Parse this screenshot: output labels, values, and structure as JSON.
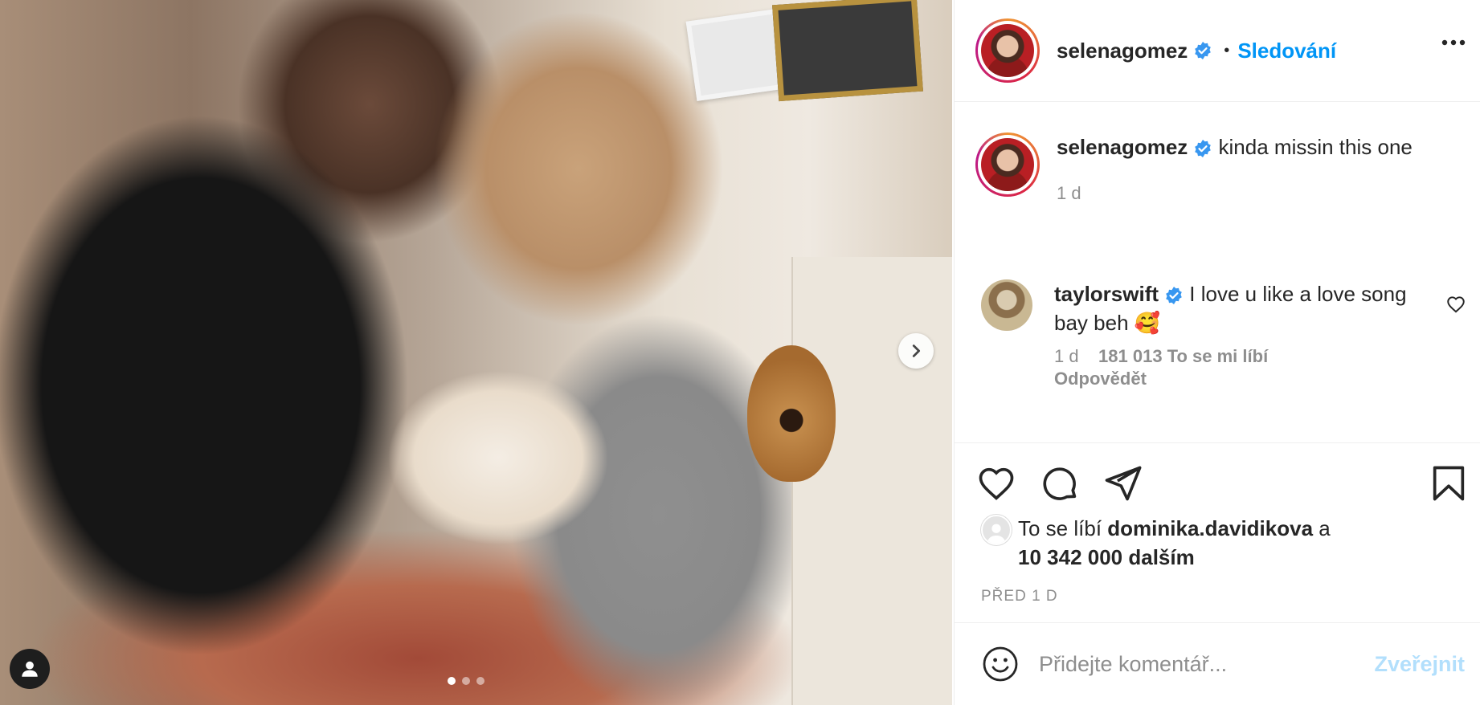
{
  "post": {
    "author": "selenagomez",
    "follow_separator": "•",
    "follow_label": "Sledování",
    "caption_text": "kinda missin this one",
    "caption_time": "1 d"
  },
  "comment": {
    "author": "taylorswift",
    "text": "I love u like a love song bay beh 🥰",
    "time": "1 d",
    "likes": "181 013 To se mi líbí",
    "reply_label": "Odpovědět"
  },
  "likes": {
    "prefix": "To se líbí",
    "user": "dominika.davidikova",
    "conjunction": "a",
    "count": "10 342 000 dalším"
  },
  "posted": "PŘED 1 D",
  "add_comment": {
    "placeholder": "Přidejte komentář...",
    "post_label": "Zveřejnit"
  },
  "carousel": {
    "count": 3,
    "active_index": 0
  },
  "colors": {
    "accent": "#0095f6",
    "verified": "#3897f0",
    "muted": "#8e8e8e",
    "post_disabled": "#b2dffc"
  }
}
